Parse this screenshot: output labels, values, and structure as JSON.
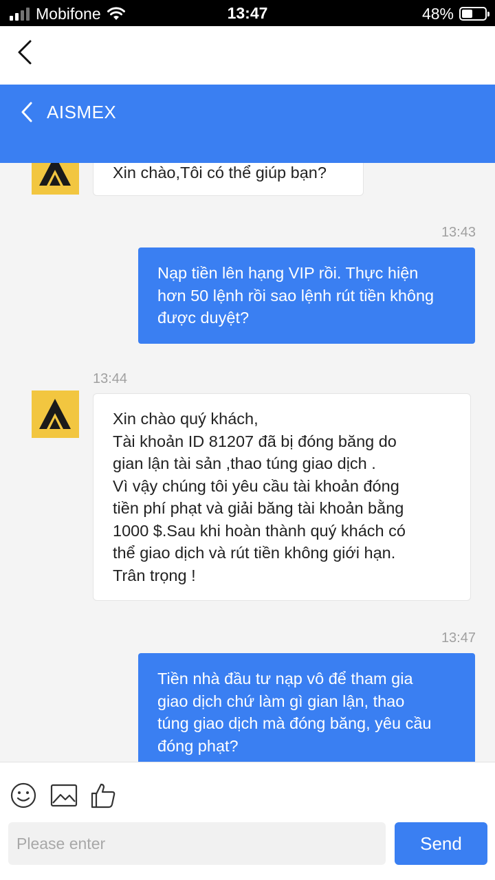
{
  "status_bar": {
    "carrier": "Mobifone",
    "time": "13:47",
    "battery_percent": "48%",
    "battery_level": 0.48
  },
  "header": {
    "title": "AISMEX"
  },
  "messages": [
    {
      "side": "in",
      "lines": [
        "Xin chào,Tôi có thể giúp bạn?"
      ]
    },
    {
      "side": "out",
      "time": "13:43",
      "lines": [
        "Nạp tiền lên hạng VIP rồi. Thực hiện",
        "hơn 50 lệnh rồi sao lệnh rút tiền không",
        "được duyệt?"
      ]
    },
    {
      "side": "in",
      "time": "13:44",
      "lines": [
        "Xin chào quý khách,",
        "Tài khoản ID 81207 đã bị đóng băng do",
        "gian lận tài sản ,thao túng giao dịch .",
        "Vì vậy chúng tôi yêu cầu tài khoản đóng",
        "tiền phí phạt và giải băng tài khoản bằng",
        "1000 $.Sau khi hoàn thành quý khách có",
        "thể giao dịch và rút tiền không giới hạn.",
        "Trân trọng !"
      ]
    },
    {
      "side": "out",
      "time": "13:47",
      "lines": [
        "Tiền nhà đầu tư nạp vô để tham gia",
        "giao dịch chứ làm gì gian lận, thao",
        "túng giao dịch mà đóng băng, yêu cầu",
        "đóng phạt?"
      ]
    }
  ],
  "input": {
    "placeholder": "Please enter",
    "value": ""
  },
  "send_label": "Send",
  "colors": {
    "accent": "#3a7ff2",
    "avatar_bg": "#f2c640"
  }
}
